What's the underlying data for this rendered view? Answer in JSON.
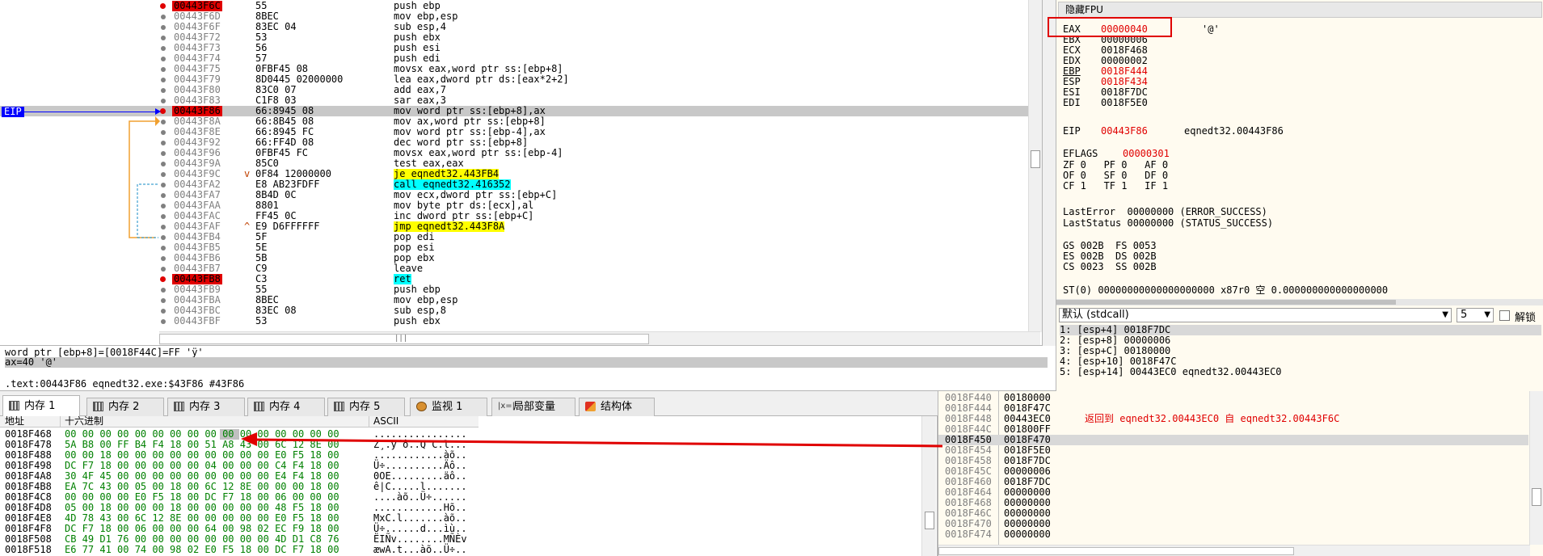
{
  "disasm": {
    "eip_label": "EIP",
    "rows": [
      {
        "addr": "00443F6C",
        "bytes": "55",
        "instr": "push ebp",
        "bp": true
      },
      {
        "addr": "00443F6D",
        "bytes": "8BEC",
        "instr": "mov ebp,esp"
      },
      {
        "addr": "00443F6F",
        "bytes": "83EC 04",
        "instr": "sub esp,4"
      },
      {
        "addr": "00443F72",
        "bytes": "53",
        "instr": "push ebx"
      },
      {
        "addr": "00443F73",
        "bytes": "56",
        "instr": "push esi"
      },
      {
        "addr": "00443F74",
        "bytes": "57",
        "instr": "push edi"
      },
      {
        "addr": "00443F75",
        "bytes": "0FBF45 08",
        "instr": "movsx eax,word ptr ss:[ebp+8]"
      },
      {
        "addr": "00443F79",
        "bytes": "8D0445 02000000",
        "instr": "lea eax,dword ptr ds:[eax*2+2]"
      },
      {
        "addr": "00443F80",
        "bytes": "83C0 07",
        "instr": "add eax,7"
      },
      {
        "addr": "00443F83",
        "bytes": "C1F8 03",
        "instr": "sar eax,3"
      },
      {
        "addr": "00443F86",
        "bytes": "66:8945 08",
        "instr": "mov word ptr ss:[ebp+8],ax",
        "bp": true,
        "cur": true
      },
      {
        "addr": "00443F8A",
        "bytes": "66:8B45 08",
        "instr": "mov ax,word ptr ss:[ebp+8]"
      },
      {
        "addr": "00443F8E",
        "bytes": "66:8945 FC",
        "instr": "mov word ptr ss:[ebp-4],ax"
      },
      {
        "addr": "00443F92",
        "bytes": "66:FF4D 08",
        "instr": "dec word ptr ss:[ebp+8]"
      },
      {
        "addr": "00443F96",
        "bytes": "0FBF45 FC",
        "instr": "movsx eax,word ptr ss:[ebp-4]"
      },
      {
        "addr": "00443F9A",
        "bytes": "85C0",
        "instr": "test eax,eax"
      },
      {
        "addr": "00443F9C",
        "bytes": "0F84 12000000",
        "instr": "je eqnedt32.443FB4",
        "jmark": "v",
        "hl": "j"
      },
      {
        "addr": "00443FA2",
        "bytes": "E8 AB23FDFF",
        "instr": "call eqnedt32.416352",
        "hl": "c"
      },
      {
        "addr": "00443FA7",
        "bytes": "8B4D 0C",
        "instr": "mov ecx,dword ptr ss:[ebp+C]"
      },
      {
        "addr": "00443FAA",
        "bytes": "8801",
        "instr": "mov byte ptr ds:[ecx],al"
      },
      {
        "addr": "00443FAC",
        "bytes": "FF45 0C",
        "instr": "inc dword ptr ss:[ebp+C]"
      },
      {
        "addr": "00443FAF",
        "bytes": "E9 D6FFFFFF",
        "instr": "jmp eqnedt32.443F8A",
        "jmark": "^",
        "hl": "j"
      },
      {
        "addr": "00443FB4",
        "bytes": "5F",
        "instr": "pop edi"
      },
      {
        "addr": "00443FB5",
        "bytes": "5E",
        "instr": "pop esi"
      },
      {
        "addr": "00443FB6",
        "bytes": "5B",
        "instr": "pop ebx"
      },
      {
        "addr": "00443FB7",
        "bytes": "C9",
        "instr": "leave"
      },
      {
        "addr": "00443FB8",
        "bytes": "C3",
        "instr": "ret",
        "bp": true,
        "hl": "c"
      },
      {
        "addr": "00443FB9",
        "bytes": "55",
        "instr": "push ebp"
      },
      {
        "addr": "00443FBA",
        "bytes": "8BEC",
        "instr": "mov ebp,esp"
      },
      {
        "addr": "00443FBC",
        "bytes": "83EC 08",
        "instr": "sub esp,8"
      },
      {
        "addr": "00443FBF",
        "bytes": "53",
        "instr": "push ebx"
      }
    ],
    "hscroll_grip": "|||"
  },
  "info": {
    "line1": "word ptr [ebp+8]=[0018F44C]=FF 'ÿ'",
    "line2": "ax=40 '@'",
    "line3": ".text:00443F86 eqnedt32.exe:$43F86 #43F86"
  },
  "registers": {
    "header": "隐藏FPU",
    "gp": [
      {
        "name": "EAX",
        "value": "00000040",
        "comment": "'@'",
        "red": true
      },
      {
        "name": "EBX",
        "value": "00000006"
      },
      {
        "name": "ECX",
        "value": "0018F468"
      },
      {
        "name": "EDX",
        "value": "00000002"
      },
      {
        "name": "EBP",
        "value": "0018F444",
        "red": true
      },
      {
        "name": "ESP",
        "value": "0018F434",
        "red": true
      },
      {
        "name": "ESI",
        "value": "0018F7DC"
      },
      {
        "name": "EDI",
        "value": "0018F5E0"
      }
    ],
    "eip": {
      "name": "EIP",
      "value": "00443F86",
      "comment": "eqnedt32.00443F86"
    },
    "eflags": {
      "name": "EFLAGS",
      "value": "00000301"
    },
    "flags": [
      "ZF 0   PF 0   AF 0",
      "OF 0   SF 0   DF 0",
      "CF 1   TF 1   IF 1"
    ],
    "last_error": "LastError  00000000 (ERROR_SUCCESS)",
    "last_status": "LastStatus 00000000 (STATUS_SUCCESS)",
    "segs": [
      "GS 002B  FS 0053",
      "ES 002B  DS 002B",
      "CS 0023  SS 002B"
    ],
    "st0": "ST(0) 00000000000000000000 x87r0 空 0.000000000000000000"
  },
  "args": {
    "convention": "默认 (stdcall)",
    "count": "5",
    "lock_label": "解锁",
    "items": [
      "1: [esp+4] 0018F7DC",
      "2: [esp+8] 00000006",
      "3: [esp+C] 00180000",
      "4: [esp+10] 0018F47C",
      "5: [esp+14] 00443EC0 eqnedt32.00443EC0"
    ]
  },
  "tabs": [
    {
      "label": "内存 1",
      "icon": "memory-icon",
      "active": true
    },
    {
      "label": "内存 2",
      "icon": "memory-icon"
    },
    {
      "label": "内存 3",
      "icon": "memory-icon"
    },
    {
      "label": "内存 4",
      "icon": "memory-icon"
    },
    {
      "label": "内存 5",
      "icon": "memory-icon"
    },
    {
      "label": "监视 1",
      "icon": "watch-icon"
    },
    {
      "label": "局部变量",
      "icon": "variable-icon"
    },
    {
      "label": "结构体",
      "icon": "struct-icon"
    }
  ],
  "dump": {
    "col_addr": "地址",
    "col_hex": "十六进制",
    "col_ascii": "ASCII",
    "rows": [
      {
        "addr": "0018F468",
        "hex": "00 00 00 00 00 00 00 00 00 00 00 00 00 00 00 00",
        "ascii": "................"
      },
      {
        "addr": "0018F478",
        "hex": "5A B8 00 FF B4 F4 18 00 51 A8 43 00 6C 12 8E 00",
        "ascii": "Z¸.ÿ´ô..Q¨C.l..."
      },
      {
        "addr": "0018F488",
        "hex": "00 00 18 00 00 00 00 00 00 00 00 00 E0 F5 18 00",
        "ascii": "............àõ.."
      },
      {
        "addr": "0018F498",
        "hex": "DC F7 18 00 00 00 00 00 04 00 00 00 C4 F4 18 00",
        "ascii": "Ü÷..........Äô.."
      },
      {
        "addr": "0018F4A8",
        "hex": "30 4F 45 00 00 00 00 00 00 00 00 00 E4 F4 18 00",
        "ascii": "0OE.........äô.."
      },
      {
        "addr": "0018F4B8",
        "hex": "EA 7C 43 00 05 00 18 00 6C 12 8E 00 00 00 18 00",
        "ascii": "ê|C.....l......."
      },
      {
        "addr": "0018F4C8",
        "hex": "00 00 00 00 E0 F5 18 00 DC F7 18 00 06 00 00 00",
        "ascii": "....àõ..Ü÷......"
      },
      {
        "addr": "0018F4D8",
        "hex": "05 00 18 00 00 00 18 00 00 00 00 00 48 F5 18 00",
        "ascii": "............Hõ.."
      },
      {
        "addr": "0018F4E8",
        "hex": "4D 78 43 00 6C 12 8E 00 00 00 00 00 E0 F5 18 00",
        "ascii": "MxC.l.......àõ.."
      },
      {
        "addr": "0018F4F8",
        "hex": "DC F7 18 00 06 00 00 00 64 00 98 02 EC F9 18 00",
        "ascii": "Ü÷......d...ìù.."
      },
      {
        "addr": "0018F508",
        "hex": "CB 49 D1 76 00 00 00 00 00 00 00 00 4D D1 C8 76",
        "ascii": "ËIÑv........MÑÈv"
      },
      {
        "addr": "0018F518",
        "hex": "E6 77 41 00 74 00 98 02 E0 F5 18 00 DC F7 18 00",
        "ascii": "æwA.t...àõ..Ü÷.."
      }
    ]
  },
  "stack": {
    "rows": [
      {
        "addr": "0018F440",
        "val": "00180000"
      },
      {
        "addr": "0018F444",
        "val": "0018F47C"
      },
      {
        "addr": "0018F448",
        "val": "00443EC0",
        "cmt": "返回到 eqnedt32.00443EC0 自 eqnedt32.00443F6C"
      },
      {
        "addr": "0018F44C",
        "val": "001800FF"
      },
      {
        "addr": "0018F450",
        "val": "0018F470",
        "sel": true
      },
      {
        "addr": "0018F454",
        "val": "0018F5E0"
      },
      {
        "addr": "0018F458",
        "val": "0018F7DC"
      },
      {
        "addr": "0018F45C",
        "val": "00000006"
      },
      {
        "addr": "0018F460",
        "val": "0018F7DC"
      },
      {
        "addr": "0018F464",
        "val": "00000000"
      },
      {
        "addr": "0018F468",
        "val": "00000000"
      },
      {
        "addr": "0018F46C",
        "val": "00000000"
      },
      {
        "addr": "0018F470",
        "val": "00000000"
      },
      {
        "addr": "0018F474",
        "val": "00000000"
      }
    ]
  },
  "colors": {
    "breakpoint": "#e00000",
    "eip": "#0000ff",
    "jump_hl": "#ffff00",
    "call_hl": "#00ffff",
    "annotation": "#e00000"
  }
}
